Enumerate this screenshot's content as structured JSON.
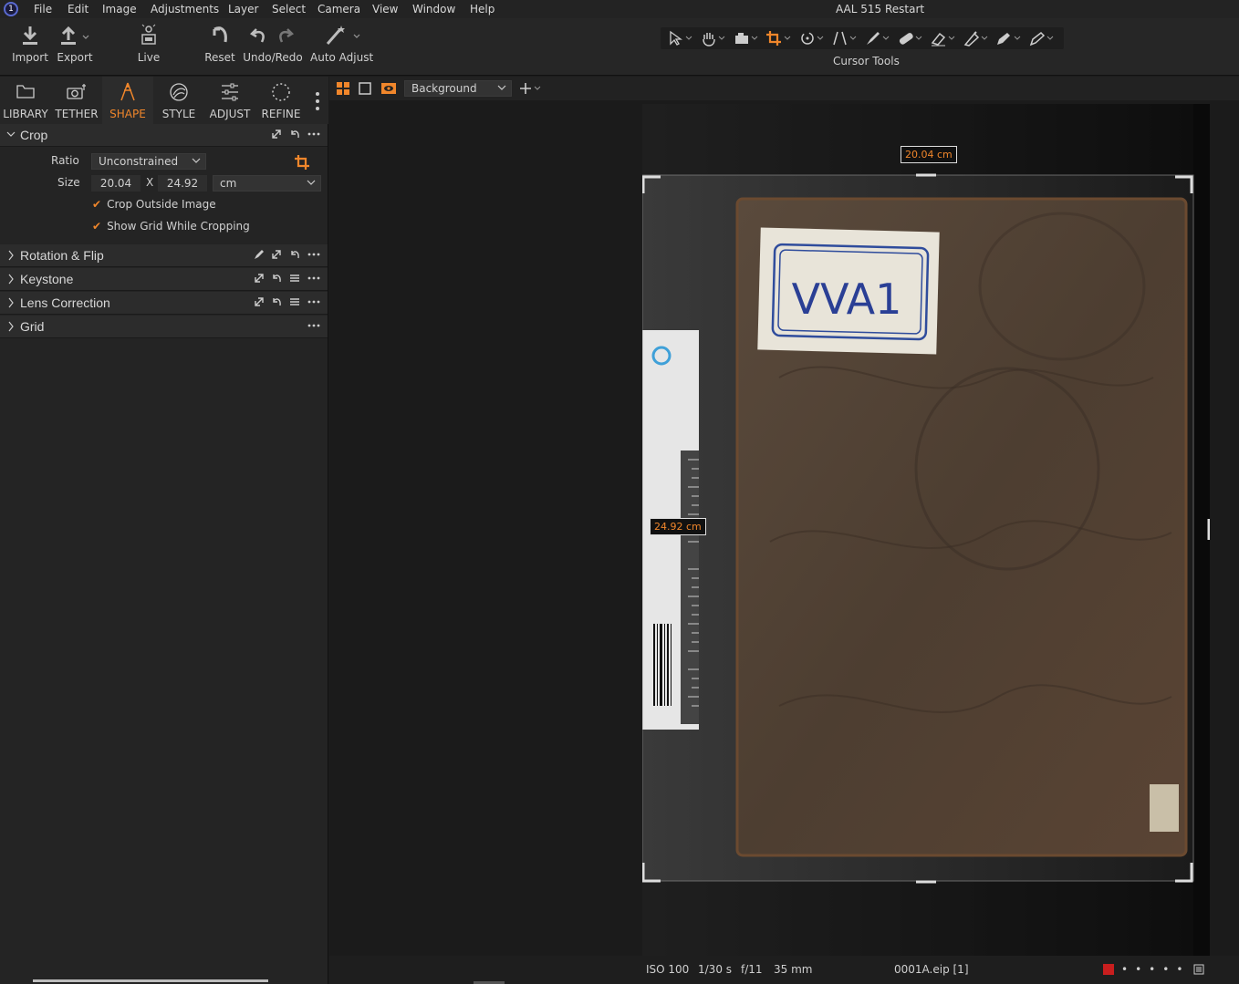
{
  "menu": {
    "items": [
      "File",
      "Edit",
      "Image",
      "Adjustments",
      "Layer",
      "Select",
      "Camera",
      "View",
      "Window",
      "Help"
    ],
    "window_title": "AAL 515 Restart"
  },
  "toolbar": {
    "import_label": "Import",
    "export_label": "Export",
    "live_label": "Live",
    "reset_label": "Reset",
    "undo_redo_label": "Undo/Redo",
    "auto_adjust_label": "Auto Adjust",
    "cursor_tools_label": "Cursor Tools"
  },
  "tool_tabs": [
    {
      "label": "LIBRARY",
      "icon": "folder-icon"
    },
    {
      "label": "TETHER",
      "icon": "camera-icon"
    },
    {
      "label": "SHAPE",
      "icon": "shape-icon",
      "active": true
    },
    {
      "label": "STYLE",
      "icon": "style-icon"
    },
    {
      "label": "ADJUST",
      "icon": "sliders-icon"
    },
    {
      "label": "REFINE",
      "icon": "refine-icon"
    }
  ],
  "crop": {
    "title": "Crop",
    "ratio_label": "Ratio",
    "ratio_value": "Unconstrained",
    "size_label": "Size",
    "width": "20.04",
    "x_sep": "X",
    "height": "24.92",
    "unit": "cm",
    "crop_outside": "Crop Outside Image",
    "show_grid": "Show Grid While Cropping"
  },
  "sections": {
    "rotation": "Rotation & Flip",
    "keystone": "Keystone",
    "lens": "Lens Correction",
    "grid": "Grid"
  },
  "viewer": {
    "layer_select": "Background",
    "width_badge": "20.04 cm",
    "height_badge": "24.92 cm",
    "label_numerals": "VVA1"
  },
  "status": {
    "iso": "ISO 100",
    "shutter": "1/30 s",
    "aperture": "f/11",
    "focal": "35 mm",
    "filename": "0001A.eip [1]"
  },
  "colors": {
    "accent": "#f0862b",
    "panel": "#242424",
    "status_red": "#c81e1e"
  }
}
